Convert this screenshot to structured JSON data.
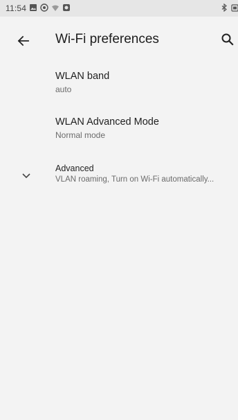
{
  "status_bar": {
    "time": "11:54",
    "icons": [
      "image-icon",
      "vpn-icon",
      "wifi-icon",
      "app-icon",
      "bluetooth-icon",
      "battery-icon"
    ]
  },
  "app_bar": {
    "title": "Wi-Fi preferences",
    "back_icon": "arrow-back-icon",
    "search_icon": "search-icon"
  },
  "preferences": [
    {
      "title": "WLAN band",
      "summary": "auto"
    },
    {
      "title": "WLAN Advanced Mode",
      "summary": "Normal mode"
    },
    {
      "title": "Advanced",
      "summary": "VLAN roaming, Turn on Wi-Fi automatically..."
    }
  ],
  "colors": {
    "background": "#f3f3f3",
    "status_bar": "#e6e6e6",
    "text_primary": "#1f1f1f",
    "text_secondary": "#6b6b6b"
  }
}
